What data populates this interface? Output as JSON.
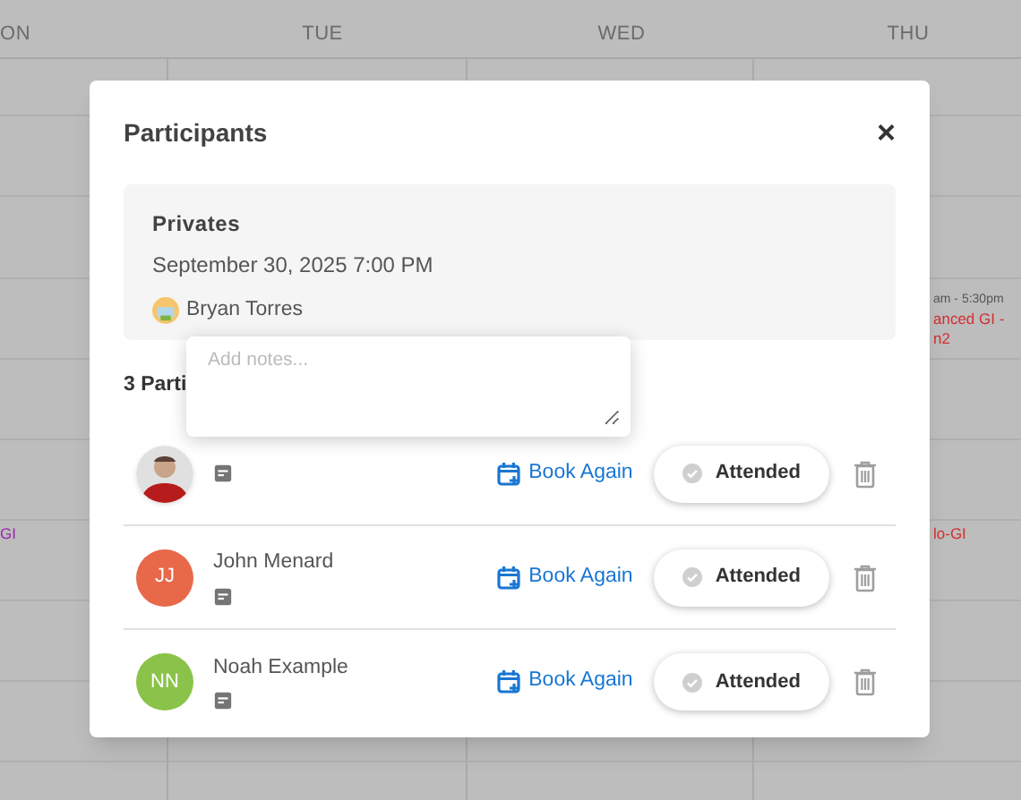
{
  "calendar": {
    "days": [
      "ON",
      "TUE",
      "WED",
      "THU"
    ],
    "right_events": [
      {
        "time": "am - 5:30pm",
        "title": "anced GI -",
        "subtitle": "n2",
        "color": "#d32f2f"
      },
      {
        "title": "lo-GI",
        "color": "#d32f2f"
      }
    ],
    "left_events": [
      {
        "title": "GI",
        "color": "#9c27b0"
      }
    ]
  },
  "dialog": {
    "title": "Participants",
    "close": "×",
    "session": {
      "name": "Privates",
      "datetime": "September 30, 2025 7:00 PM",
      "instructor": "Bryan Torres"
    },
    "count_label": "3 Parti",
    "notes_popover": {
      "placeholder": "Add notes..."
    },
    "participants": [
      {
        "book_again": "Book Again",
        "attendance": "Attended",
        "marked": false
      },
      {
        "kind": "initials",
        "initials": "JJ",
        "name": "John Menard",
        "color": "#e8684a",
        "book_again": "Book Again",
        "attendance": "Attended",
        "marked": false
      },
      {
        "kind": "initials",
        "initials": "NN",
        "name": "Noah Example",
        "color": "#8bc34a",
        "book_again": "Book Again",
        "attendance": "Attended",
        "marked": false
      }
    ]
  }
}
